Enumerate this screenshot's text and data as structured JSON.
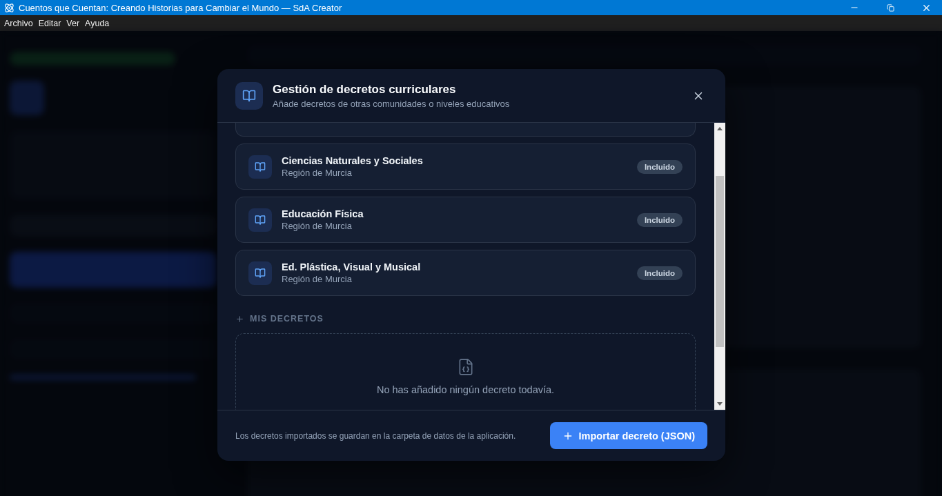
{
  "window": {
    "title": "Cuentos que Cuentan: Creando Historias para Cambiar el Mundo  — SdA Creator",
    "menu": [
      "Archivo",
      "Editar",
      "Ver",
      "Ayuda"
    ]
  },
  "dialog": {
    "title": "Gestión de decretos curriculares",
    "subtitle": "Añade decretos de otras comunidades o niveles educativos",
    "decrees": [
      {
        "name": "Ciencias Naturales y Sociales",
        "region": "Región de Murcia",
        "badge": "Incluido"
      },
      {
        "name": "Educación Física",
        "region": "Región de Murcia",
        "badge": "Incluido"
      },
      {
        "name": "Ed. Plástica, Visual y Musical",
        "region": "Región de Murcia",
        "badge": "Incluido"
      }
    ],
    "section_label": "MIS DECRETOS",
    "empty_message": "No has añadido ningún decreto todavía.",
    "footer_note": "Los decretos importados se guardan en la carpeta de datos de la aplicación.",
    "import_button": "Importar decreto (JSON)"
  }
}
